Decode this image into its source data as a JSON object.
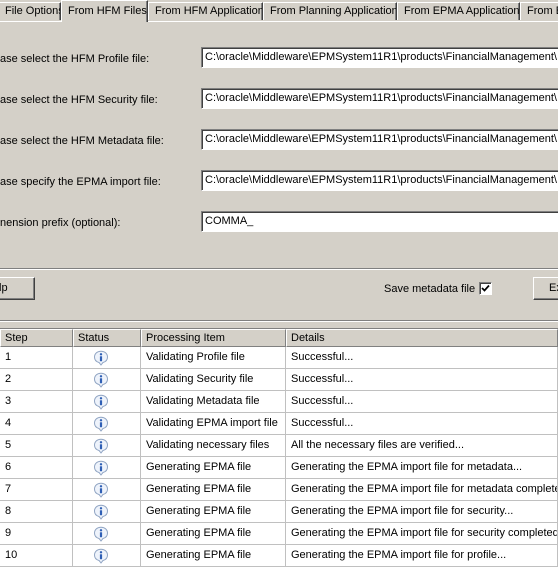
{
  "tabs": [
    {
      "label": "File Options",
      "active": false
    },
    {
      "label": "From HFM Files",
      "active": true
    },
    {
      "label": "From HFM Application",
      "active": false
    },
    {
      "label": "From Planning Application",
      "active": false
    },
    {
      "label": "From EPMA Application",
      "active": false
    },
    {
      "label": "From E",
      "active": false
    }
  ],
  "form": {
    "rows": [
      {
        "label": "ase select the HFM Profile file:",
        "value": "C:\\oracle\\Middleware\\EPMSystem11R1\\products\\FinancialManagement\\"
      },
      {
        "label": "ase select the HFM Security file:",
        "value": "C:\\oracle\\Middleware\\EPMSystem11R1\\products\\FinancialManagement\\"
      },
      {
        "label": "ase select the HFM Metadata file:",
        "value": "C:\\oracle\\Middleware\\EPMSystem11R1\\products\\FinancialManagement\\"
      },
      {
        "label": "ase specify the EPMA import file:",
        "value": "C:\\oracle\\Middleware\\EPMSystem11R1\\products\\FinancialManagement\\"
      },
      {
        "label": "nension prefix (optional):",
        "value": "COMMA_"
      }
    ]
  },
  "buttons": {
    "help": "lp",
    "save_metadata_label": "Save metadata file",
    "save_metadata_checked": true,
    "execute": "Ex"
  },
  "grid": {
    "columns": [
      "Step",
      "Status",
      "Processing Item",
      "Details"
    ],
    "rows": [
      {
        "step": "1",
        "status_icon": "info-icon",
        "item": "Validating Profile file",
        "details": "Successful..."
      },
      {
        "step": "2",
        "status_icon": "info-icon",
        "item": "Validating Security file",
        "details": "Successful..."
      },
      {
        "step": "3",
        "status_icon": "info-icon",
        "item": "Validating Metadata file",
        "details": "Successful..."
      },
      {
        "step": "4",
        "status_icon": "info-icon",
        "item": "Validating EPMA import file",
        "details": "Successful..."
      },
      {
        "step": "5",
        "status_icon": "info-icon",
        "item": "Validating necessary files",
        "details": "All the necessary files are verified..."
      },
      {
        "step": "6",
        "status_icon": "info-icon",
        "item": "Generating EPMA file",
        "details": "Generating the EPMA import file for metadata..."
      },
      {
        "step": "7",
        "status_icon": "info-icon",
        "item": "Generating EPMA file",
        "details": "Generating the EPMA import file for metadata completed!"
      },
      {
        "step": "8",
        "status_icon": "info-icon",
        "item": "Generating EPMA file",
        "details": "Generating the EPMA import file for security..."
      },
      {
        "step": "9",
        "status_icon": "info-icon",
        "item": "Generating EPMA file",
        "details": "Generating the EPMA import file for security completed!"
      },
      {
        "step": "10",
        "status_icon": "info-icon",
        "item": "Generating EPMA file",
        "details": "Generating the EPMA import file for profile..."
      }
    ]
  },
  "colors": {
    "window_bg": "#d4d0c8",
    "grid_bg": "#ffffff",
    "info_icon_blue": "#2f5fb5"
  }
}
